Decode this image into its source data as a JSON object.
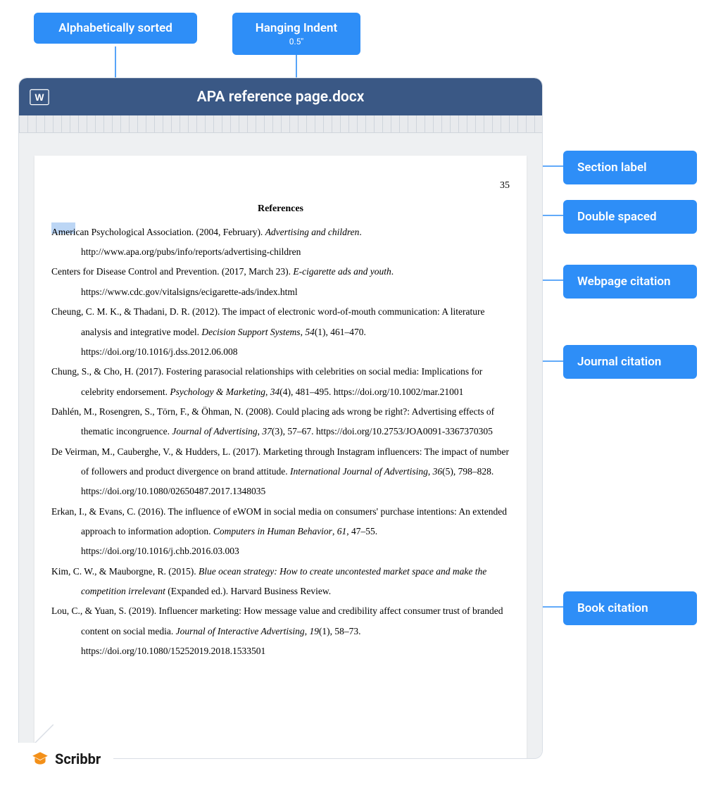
{
  "labels": {
    "alpha_sorted": "Alphabetically sorted",
    "hanging_indent": "Hanging Indent",
    "hanging_indent_sub": "0.5\"",
    "section_label": "Section label",
    "double_spaced": "Double spaced",
    "webpage_citation": "Webpage citation",
    "journal_citation": "Journal citation",
    "book_citation": "Book citation"
  },
  "document": {
    "title": "APA reference page.docx",
    "page_number": "35",
    "references_heading": "References",
    "entries": [
      {
        "html": "American Psychological Association. (2004, February). <em>Advertising and children</em>. http://www.apa.org/pubs/info/reports/advertising-children"
      },
      {
        "html": "Centers for Disease Control and Prevention. (2017, March 23). <em>E-cigarette ads and youth</em>. https://www.cdc.gov/vitalsigns/ecigarette-ads/index.html"
      },
      {
        "html": "Cheung, C. M. K., & Thadani, D. R. (2012). The impact of electronic word-of-mouth communication: A literature analysis and integrative model. <em>Decision Support Systems</em>, <em>54</em>(1), 461–470. https://doi.org/10.1016/j.dss.2012.06.008"
      },
      {
        "html": "Chung, S., & Cho, H. (2017). Fostering parasocial relationships with celebrities on social media: Implications for celebrity endorsement. <em>Psychology & Marketing</em>, <em>34</em>(4), 481–495. https://doi.org/10.1002/mar.21001"
      },
      {
        "html": "Dahlén, M., Rosengren, S., Törn, F., & Öhman, N. (2008). Could placing ads wrong be right?: Advertising effects of thematic incongruence. <em>Journal of Advertising</em>, <em>37</em>(3), 57–67. https://doi.org/10.2753/JOA0091-3367370305"
      },
      {
        "html": "De Veirman, M., Cauberghe, V., & Hudders, L. (2017). Marketing through Instagram influencers: The impact of number of followers and product divergence on brand attitude. <em>International Journal of Advertising</em>, <em>36</em>(5), 798–828. https://doi.org/10.1080/02650487.2017.1348035"
      },
      {
        "html": "Erkan, I., & Evans, C. (2016). The influence of eWOM in social media on consumers' purchase intentions: An extended approach to information adoption. <em>Computers in Human Behavior</em>, <em>61</em>, 47–55. https://doi.org/10.1016/j.chb.2016.03.003"
      },
      {
        "html": "Kim, C. W., & Mauborgne, R. (2015). <em>Blue ocean strategy: How to create uncontested market space and make the competition irrelevant</em> (Expanded ed.). Harvard Business Review."
      },
      {
        "html": "Lou, C., & Yuan, S. (2019). Influencer marketing: How message value and credibility affect consumer trust of branded content on social media. <em>Journal of Interactive Advertising</em>, <em>19</em>(1), 58–73. https://doi.org/10.1080/15252019.2018.1533501"
      }
    ]
  },
  "logo_text": "Scribbr"
}
